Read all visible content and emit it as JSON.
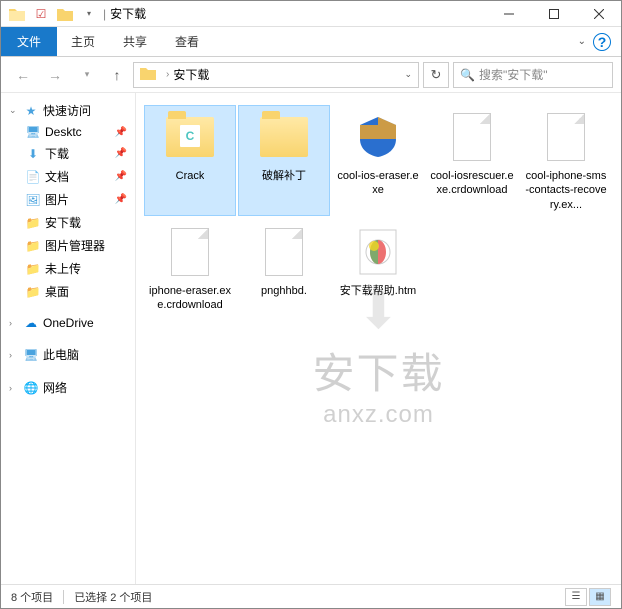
{
  "titlebar": {
    "title": "安下载"
  },
  "ribbon": {
    "file": "文件",
    "tabs": [
      "主页",
      "共享",
      "查看"
    ]
  },
  "nav": {
    "breadcrumb": "安下载",
    "search_placeholder": "搜索\"安下载\""
  },
  "tree": {
    "quick_access": "快速访问",
    "items": [
      {
        "label": "Desktc",
        "pinned": true
      },
      {
        "label": "下载",
        "pinned": true
      },
      {
        "label": "文档",
        "pinned": true
      },
      {
        "label": "图片",
        "pinned": true
      },
      {
        "label": "安下载",
        "pinned": false
      },
      {
        "label": "图片管理器",
        "pinned": false
      },
      {
        "label": "未上传",
        "pinned": false
      },
      {
        "label": "桌面",
        "pinned": false
      }
    ],
    "onedrive": "OneDrive",
    "this_pc": "此电脑",
    "network": "网络"
  },
  "files": [
    {
      "name": "Crack",
      "type": "folder-c",
      "selected": true
    },
    {
      "name": "破解补丁",
      "type": "folder",
      "selected": true
    },
    {
      "name": "cool-ios-eraser.exe",
      "type": "exe-shield",
      "selected": false
    },
    {
      "name": "cool-iosrescuer.exe.crdownload",
      "type": "blank",
      "selected": false
    },
    {
      "name": "cool-iphone-sms-contacts-recovery.ex...",
      "type": "blank",
      "selected": false
    },
    {
      "name": "iphone-eraser.exe.crdownload",
      "type": "blank",
      "selected": false
    },
    {
      "name": "pnghhbd.",
      "type": "blank",
      "selected": false
    },
    {
      "name": "安下载帮助.htm",
      "type": "htm",
      "selected": false
    }
  ],
  "status": {
    "count": "8 个项目",
    "selected": "已选择 2 个项目"
  },
  "watermark": {
    "line1": "安下载",
    "line2": "anxz.com"
  }
}
